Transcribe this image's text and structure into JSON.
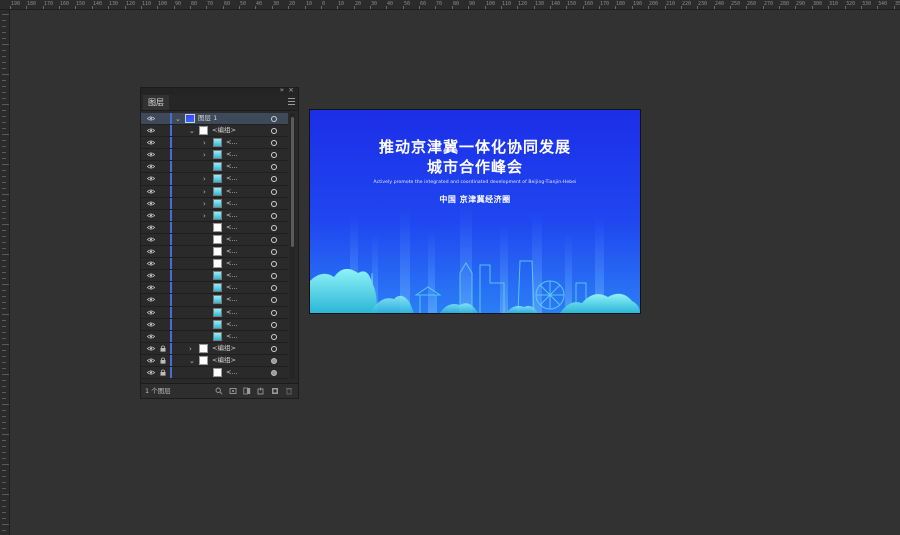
{
  "ruler": {
    "top_labels": [
      "190",
      "180",
      "170",
      "160",
      "150",
      "140",
      "130",
      "120",
      "110",
      "100",
      "90",
      "80",
      "70",
      "60",
      "50",
      "40",
      "30",
      "20",
      "10",
      "0",
      "10",
      "20",
      "30",
      "40",
      "50",
      "60",
      "70",
      "80",
      "90",
      "100",
      "110",
      "120",
      "130",
      "140",
      "150",
      "160",
      "170",
      "180",
      "190",
      "200",
      "210",
      "220",
      "230",
      "240",
      "250",
      "260",
      "270",
      "280",
      "290",
      "300",
      "310",
      "320",
      "330",
      "340",
      "350"
    ]
  },
  "panel": {
    "tab_label": "图层",
    "collapse_glyph": "»",
    "close_glyph": "×",
    "footer_count": "1 个图层",
    "rows": [
      {
        "label": "图层 1",
        "level": 0,
        "expanded": true,
        "thumb": "layer",
        "selected": true,
        "locked": false,
        "target": "ring"
      },
      {
        "label": "<编组>",
        "level": 1,
        "expanded": true,
        "thumb": "white",
        "locked": false,
        "target": "ring"
      },
      {
        "label": "<...",
        "level": 2,
        "arrow": true,
        "thumb": "blue",
        "locked": false,
        "target": "ring"
      },
      {
        "label": "<...",
        "level": 2,
        "arrow": true,
        "thumb": "blue",
        "locked": false,
        "target": "ring"
      },
      {
        "label": "<...",
        "level": 2,
        "arrow": false,
        "thumb": "blue",
        "locked": false,
        "target": "ring"
      },
      {
        "label": "<...",
        "level": 2,
        "arrow": true,
        "thumb": "blue",
        "locked": false,
        "target": "ring"
      },
      {
        "label": "<...",
        "level": 2,
        "arrow": true,
        "thumb": "blue",
        "locked": false,
        "target": "ring"
      },
      {
        "label": "<...",
        "level": 2,
        "arrow": true,
        "thumb": "blue",
        "locked": false,
        "target": "ring"
      },
      {
        "label": "<...",
        "level": 2,
        "arrow": true,
        "thumb": "blue",
        "locked": false,
        "target": "ring"
      },
      {
        "label": "<...",
        "level": 2,
        "arrow": false,
        "thumb": "white",
        "locked": false,
        "target": "ring"
      },
      {
        "label": "<...",
        "level": 2,
        "arrow": false,
        "thumb": "white",
        "locked": false,
        "target": "ring"
      },
      {
        "label": "<...",
        "level": 2,
        "arrow": false,
        "thumb": "white",
        "locked": false,
        "target": "ring"
      },
      {
        "label": "<...",
        "level": 2,
        "arrow": false,
        "thumb": "white",
        "locked": false,
        "target": "ring"
      },
      {
        "label": "<...",
        "level": 2,
        "arrow": false,
        "thumb": "blue",
        "locked": false,
        "target": "ring"
      },
      {
        "label": "<...",
        "level": 2,
        "arrow": false,
        "thumb": "blue",
        "locked": false,
        "target": "ring"
      },
      {
        "label": "<...",
        "level": 2,
        "arrow": false,
        "thumb": "blue",
        "locked": false,
        "target": "ring"
      },
      {
        "label": "<...",
        "level": 2,
        "arrow": false,
        "thumb": "blue",
        "locked": false,
        "target": "ring"
      },
      {
        "label": "<...",
        "level": 2,
        "arrow": false,
        "thumb": "blue",
        "locked": false,
        "target": "ring"
      },
      {
        "label": "<...",
        "level": 2,
        "arrow": false,
        "thumb": "blue",
        "locked": false,
        "target": "ring"
      },
      {
        "label": "<编组>",
        "level": 1,
        "expanded": false,
        "thumb": "white",
        "locked": true,
        "target": "ring"
      },
      {
        "label": "<编组>",
        "level": 1,
        "expanded": true,
        "thumb": "white",
        "locked": true,
        "target": "filled"
      },
      {
        "label": "<...",
        "level": 2,
        "arrow": false,
        "thumb": "white",
        "locked": true,
        "target": "filled"
      },
      {
        "label": "<...",
        "level": 2,
        "arrow": false,
        "thumb": "white",
        "locked": true,
        "target": "filled"
      }
    ],
    "footer_icons": [
      "search-icon",
      "collect-for-export-icon",
      "clipping-mask-icon",
      "new-sublayer-icon",
      "new-layer-icon",
      "delete-icon"
    ]
  },
  "artboard": {
    "title_line1": "推动京津冀一体化协同发展",
    "title_line2": "城市合作峰会",
    "subtitle": "Actively promote the integrated and coordinated development of Beijing-Tianjin-Hebei",
    "org": "中国 京津冀经济圈"
  },
  "colors": {
    "workspace": "#323232",
    "panel": "#2a2a2a",
    "selected_row": "#3e4a5a",
    "layer_color": "#4a6cd6",
    "artboard_top": "#1c2ee8",
    "artboard_bottom": "#2b7ef5",
    "skyline": "#47d6e8"
  }
}
